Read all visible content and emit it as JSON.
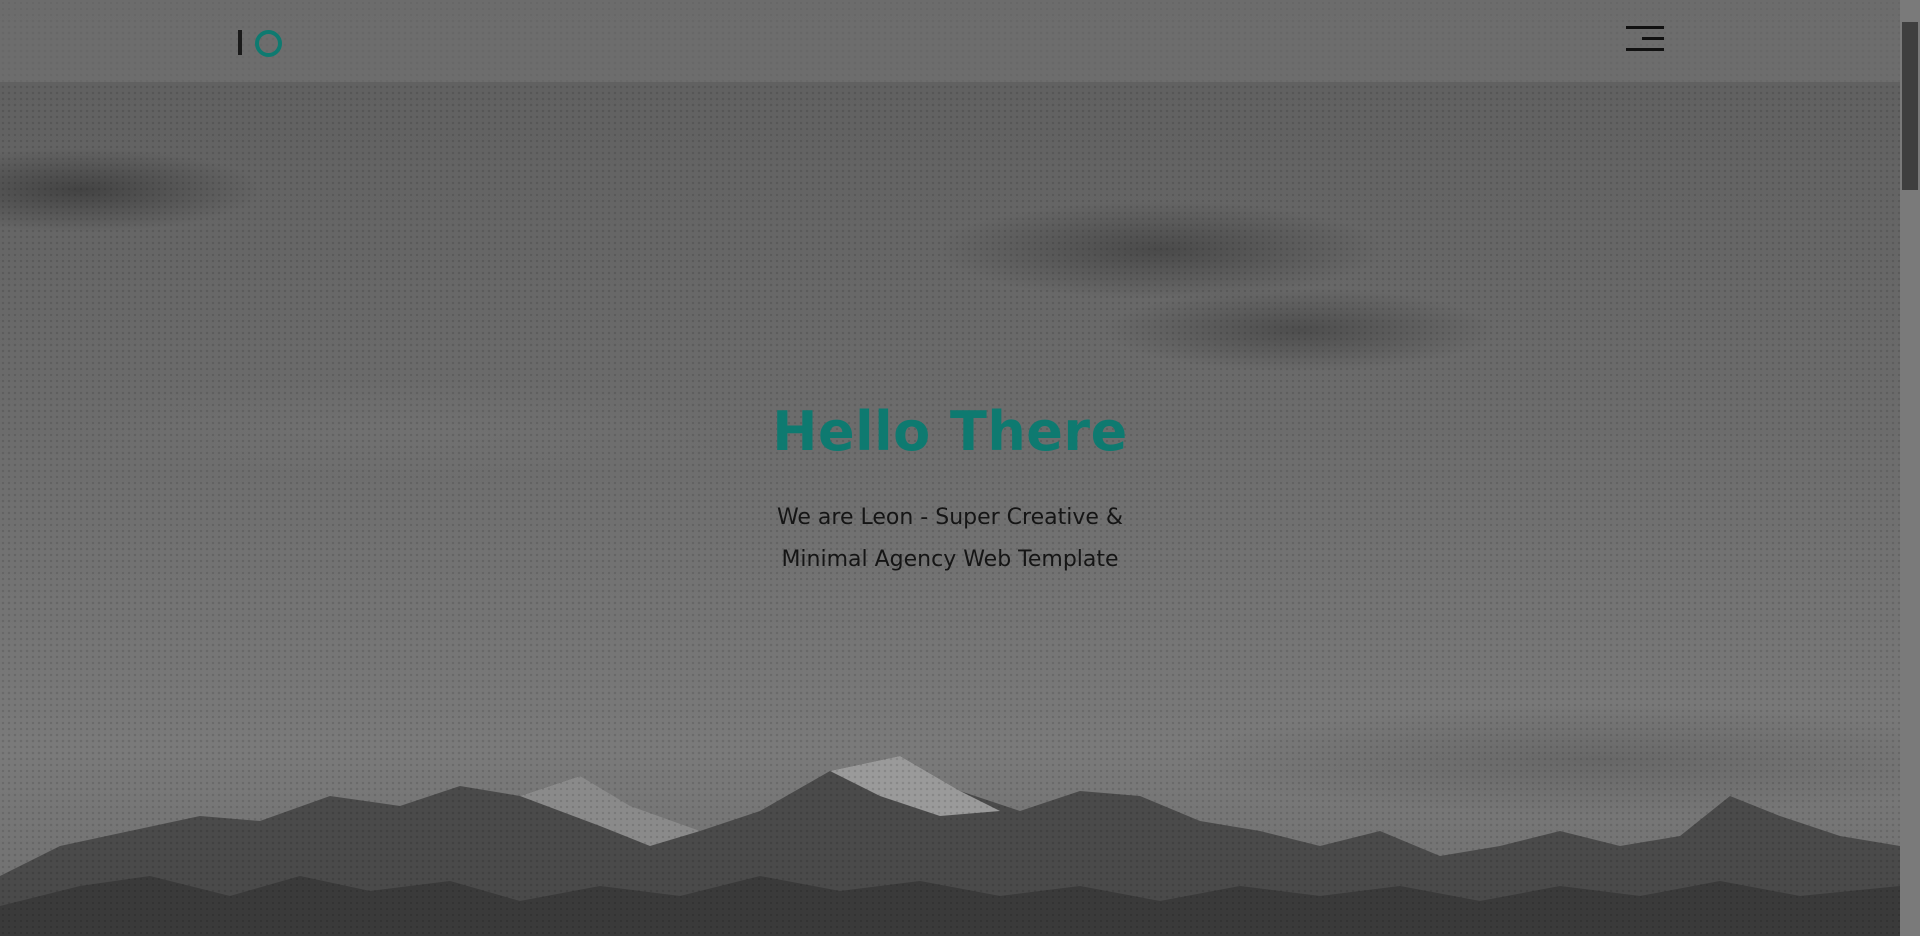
{
  "brand": {
    "logo_icon": "io-logo-icon",
    "accent_color": "#0e7a70"
  },
  "header": {
    "menu_icon": "hamburger-menu-icon"
  },
  "hero": {
    "title": "Hello There",
    "subtitle_line1": "We are Leon - Super Creative &",
    "subtitle_line2": "Minimal Agency Web Template",
    "background": "snowy-mountains-image"
  }
}
